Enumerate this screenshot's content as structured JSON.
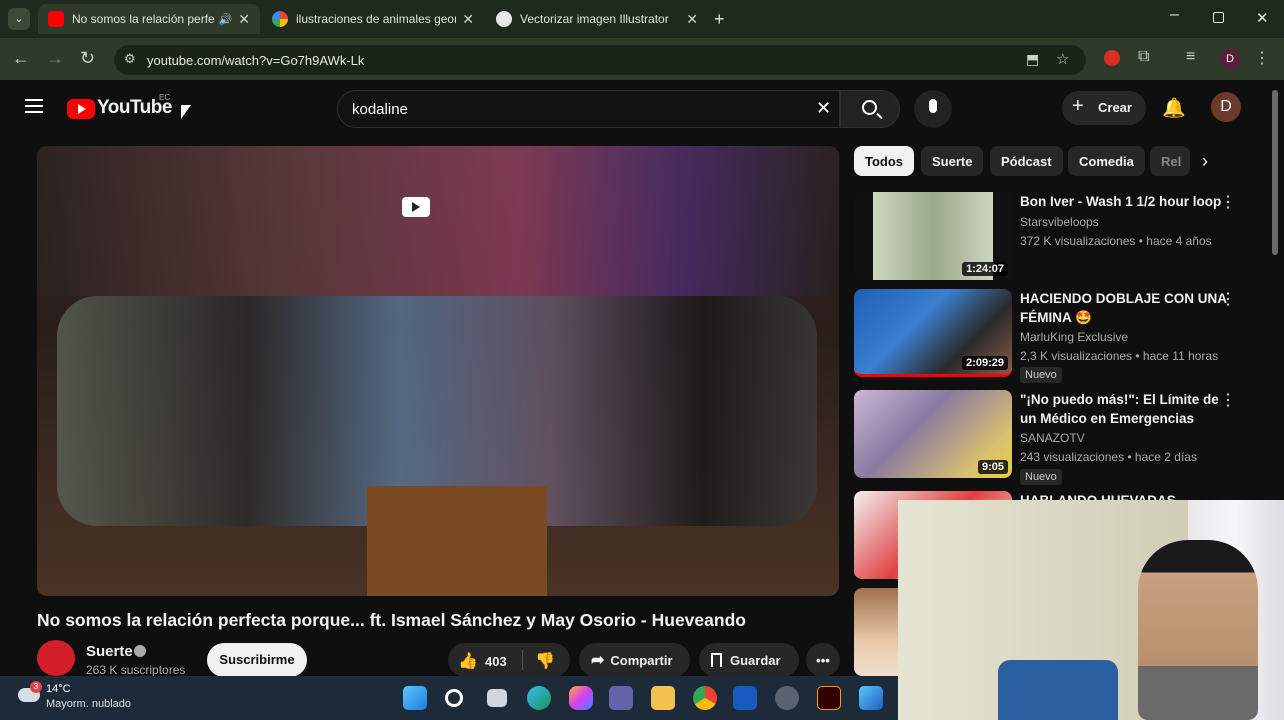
{
  "browser": {
    "tabs": [
      {
        "label": "No somos la relación perfec",
        "active": true
      },
      {
        "label": "ilustraciones de animales geom",
        "active": false
      },
      {
        "label": "Vectorizar imagen Illustrator",
        "active": false
      }
    ],
    "url": "youtube.com/watch?v=Go7h9AWk-Lk",
    "profile_initial": "D"
  },
  "youtube": {
    "logo_text": "YouTube",
    "region": "EC",
    "search_value": "kodaline",
    "create_label": "Crear",
    "avatar_initial": "D",
    "chips": [
      "Todos",
      "Suerte",
      "Pódcast",
      "Comedia",
      "Rel"
    ],
    "video": {
      "title": "No somos la relación perfecta porque... ft. Ismael Sánchez y May Osorio - Hueveando",
      "channel": "Suerte",
      "subscribers": "263 K suscriptores",
      "subscribe_label": "Suscribirme",
      "likes": "403",
      "share_label": "Compartir",
      "save_label": "Guardar"
    },
    "recommendations": [
      {
        "title": "Bon Iver - Wash  1 1/2 hour loop",
        "channel": "Starsvibeloops",
        "meta": "372 K visualizaciones • hace 4 años",
        "duration": "1:24:07",
        "badge": ""
      },
      {
        "title": "HACIENDO DOBLAJE CON UNA FÉMINA 🤩",
        "channel": "MarluKing Exclusive",
        "meta": "2,3 K visualizaciones • hace 11 horas",
        "duration": "2:09:29",
        "badge": "Nuevo"
      },
      {
        "title": "\"¡No puedo más!\": El Límite de un Médico en Emergencias",
        "channel": "SANAZOTV",
        "meta": "243 visualizaciones • hace 2 días",
        "duration": "9:05",
        "badge": "Nuevo"
      },
      {
        "title": "HABLANDO HUEVADAS-",
        "channel": "",
        "meta": "",
        "duration": "",
        "badge": ""
      }
    ]
  },
  "taskbar": {
    "weather_temp": "14°C",
    "weather_desc": "Mayorm. nublado",
    "weather_badge": "3"
  },
  "colors": {
    "yt_red": "#ff0000",
    "browser_green": "#2e3b2b"
  }
}
